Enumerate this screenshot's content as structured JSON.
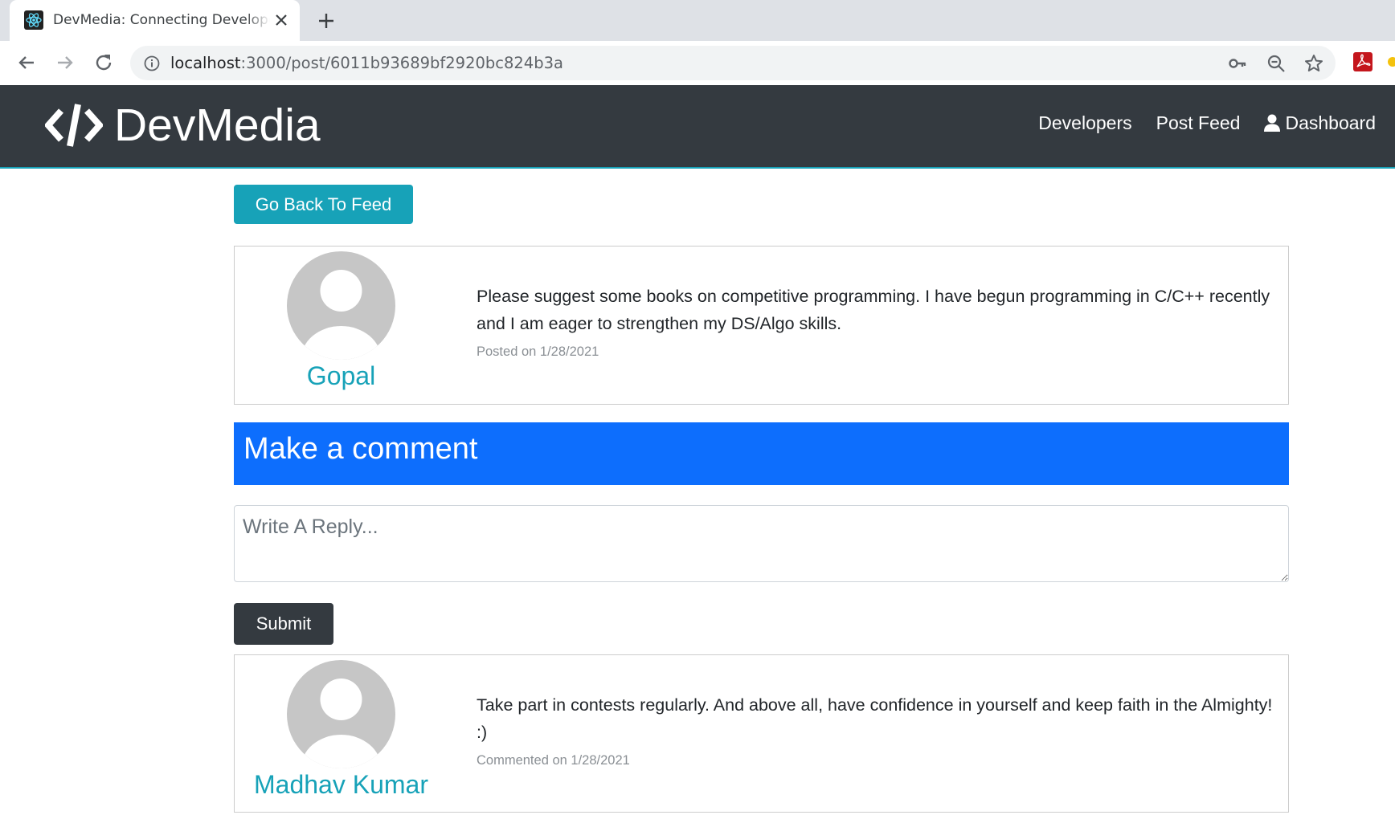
{
  "browser": {
    "tab_title": "DevMedia: Connecting Developers",
    "url_host": "localhost",
    "url_path": ":3000/post/6011b93689bf2920bc824b3a"
  },
  "navbar": {
    "brand": "DevMedia",
    "links": [
      "Developers",
      "Post Feed",
      "Dashboard"
    ]
  },
  "page": {
    "back_button": "Go Back To Feed",
    "post": {
      "author": "Gopal",
      "text": "Please suggest some books on competitive programming. I have begun programming in C/C++ recently and I am eager to strengthen my DS/Algo skills.",
      "date": "Posted on 1/28/2021"
    },
    "comment_form": {
      "heading": "Make a comment",
      "placeholder": "Write A Reply...",
      "submit": "Submit"
    },
    "comments": [
      {
        "author": "Madhav Kumar",
        "text": "Take part in contests regularly. And above all, have confidence in yourself and keep faith in the Almighty! :)",
        "date": "Commented on 1/28/2021"
      }
    ]
  },
  "colors": {
    "navbar_bg": "#343a40",
    "accent_teal": "#17a2b8",
    "primary_blue": "#0d6efd",
    "dark_button": "#343a40"
  },
  "icons": [
    "react-favicon-icon",
    "close-icon",
    "plus-icon",
    "back-arrow-icon",
    "forward-arrow-icon",
    "reload-icon",
    "info-icon",
    "key-icon",
    "zoom-icon",
    "star-icon",
    "pdf-extension-icon",
    "code-logo-icon",
    "user-icon",
    "avatar-icon"
  ]
}
